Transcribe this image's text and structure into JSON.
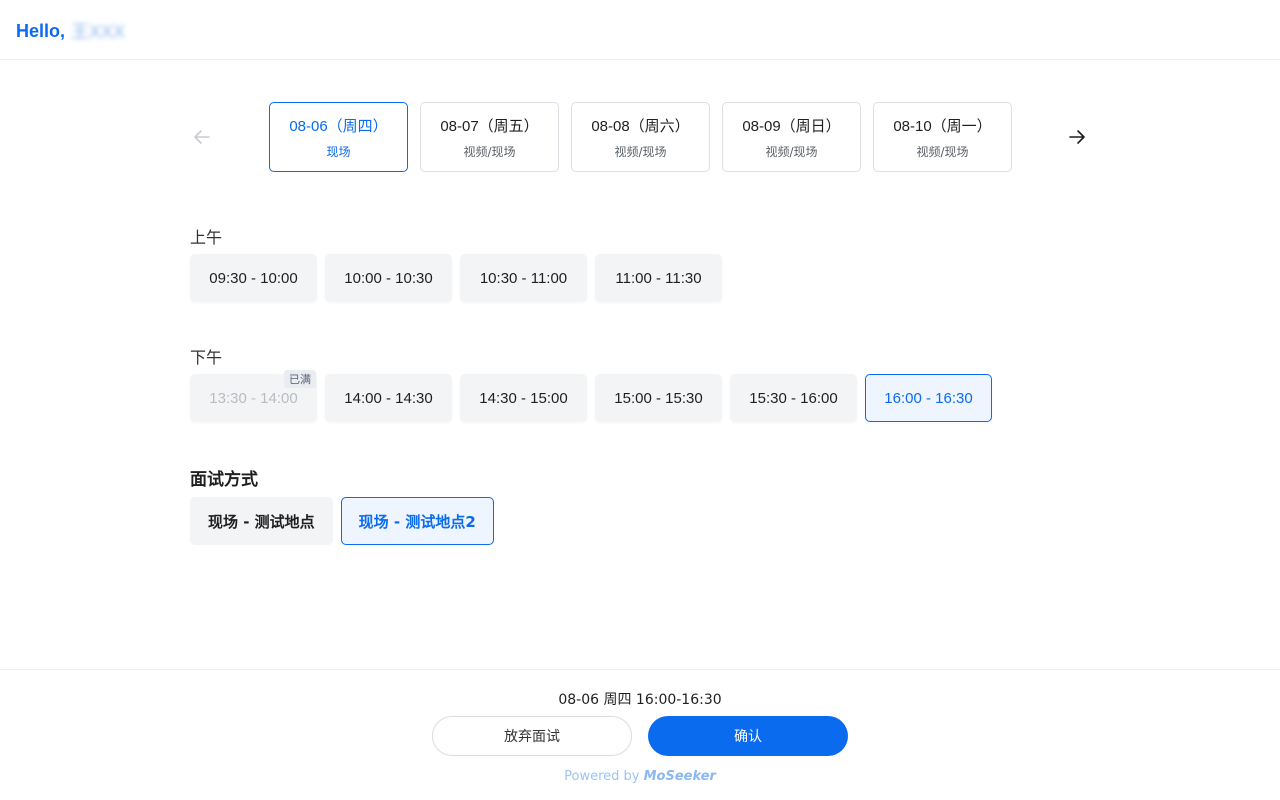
{
  "header": {
    "greeting": "Hello,",
    "user_name": "王XXX"
  },
  "nav": {
    "prev_icon": "arrow-left-icon",
    "next_icon": "arrow-right-icon"
  },
  "dates": [
    {
      "date": "08-06（周四）",
      "mode": "现场",
      "selected": true
    },
    {
      "date": "08-07（周五）",
      "mode": "视频/现场",
      "selected": false
    },
    {
      "date": "08-08（周六）",
      "mode": "视频/现场",
      "selected": false
    },
    {
      "date": "08-09（周日）",
      "mode": "视频/现场",
      "selected": false
    },
    {
      "date": "08-10（周一）",
      "mode": "视频/现场",
      "selected": false
    }
  ],
  "morning": {
    "label": "上午",
    "slots": [
      "09:30 - 10:00",
      "10:00 - 10:30",
      "10:30 - 11:00",
      "11:00 - 11:30"
    ]
  },
  "afternoon": {
    "label": "下午",
    "full_badge": "已满",
    "slots": [
      "13:30 - 14:00",
      "14:00 - 14:30",
      "14:30 - 15:00",
      "15:00 - 15:30",
      "15:30 - 16:00",
      "16:00 - 16:30"
    ]
  },
  "method": {
    "title": "面试方式",
    "options": [
      "现场 - 测试地点",
      "现场 - 测试地点2"
    ]
  },
  "footer": {
    "summary": "08-06 周四 16:00-16:30",
    "giveup_label": "放弃面试",
    "confirm_label": "确认",
    "powered_prefix": "Powered by",
    "powered_brand": "MoSeeker"
  },
  "colors": {
    "accent": "#0b6bef",
    "slot_bg": "#f3f4f6",
    "selected_bg": "#eef5ff"
  }
}
